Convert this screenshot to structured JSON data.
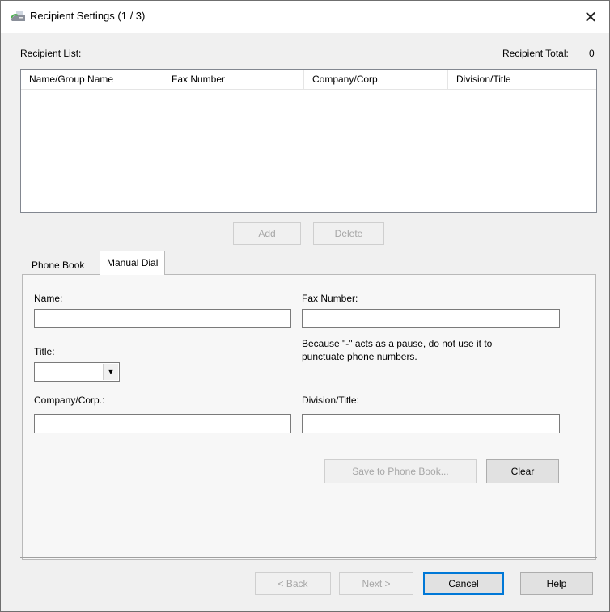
{
  "window": {
    "title": "Recipient Settings (1 / 3)",
    "close_glyph": "✕",
    "icon": "fax-icon"
  },
  "recipient_list": {
    "label": "Recipient List:",
    "total_label": "Recipient Total:",
    "total_value": "0",
    "columns": [
      "Name/Group Name",
      "Fax Number",
      "Company/Corp.",
      "Division/Title"
    ],
    "rows": []
  },
  "list_buttons": {
    "add": "Add",
    "delete": "Delete"
  },
  "tabs": [
    {
      "label": "Phone Book",
      "active": false
    },
    {
      "label": "Manual Dial",
      "active": true
    }
  ],
  "manual_dial": {
    "name_label": "Name:",
    "name_value": "",
    "fax_label": "Fax Number:",
    "fax_value": "",
    "fax_hint_line1": "Because \"-\" acts as a pause, do not use it to",
    "fax_hint_line2": "punctuate phone numbers.",
    "title_label": "Title:",
    "title_value": "",
    "company_label": "Company/Corp.:",
    "company_value": "",
    "division_label": "Division/Title:",
    "division_value": "",
    "save_button": "Save to Phone Book...",
    "clear_button": "Clear"
  },
  "footer": {
    "back": "< Back",
    "next": "Next >",
    "cancel": "Cancel",
    "help": "Help"
  }
}
